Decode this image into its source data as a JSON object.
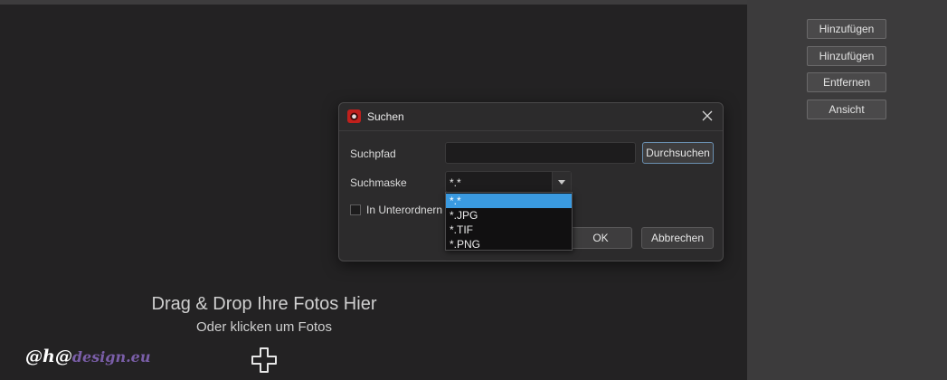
{
  "side_buttons": [
    {
      "label": "Hinzufügen"
    },
    {
      "label": "Hinzufügen"
    },
    {
      "label": "Entfernen"
    },
    {
      "label": "Ansicht"
    }
  ],
  "drop_area": {
    "title": "Drag & Drop Ihre Fotos Hier",
    "subtitle": "Oder klicken um Fotos",
    "icon": "plus-icon"
  },
  "watermark": {
    "part1": "@h@",
    "part2": "design.eu"
  },
  "dialog": {
    "title": "Suchen",
    "path_label": "Suchpfad",
    "path_value": "",
    "browse_label": "Durchsuchen",
    "mask_label": "Suchmaske",
    "mask_value": "*.*",
    "subfolders_label": "In Unterordnern",
    "subfolders_checked": false,
    "ok_label": "OK",
    "cancel_label": "Abbrechen",
    "mask_options": [
      "*.*",
      "*.JPG",
      "*.TIF",
      "*.PNG"
    ],
    "selected_option": "*.*"
  },
  "colors": {
    "accent": "#3a9ae0",
    "background": "#232223",
    "panel": "#3c3b3c"
  }
}
